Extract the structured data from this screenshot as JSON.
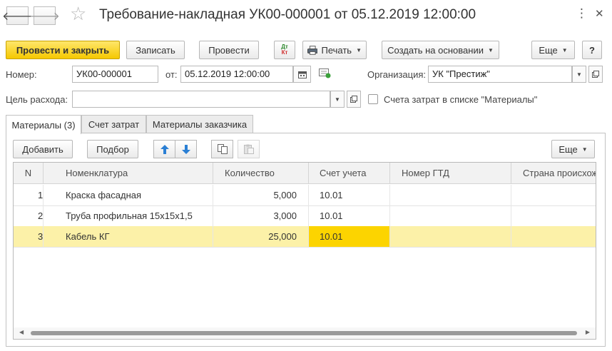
{
  "header": {
    "title": "Требование-накладная УК00-000001 от 05.12.2019 12:00:00",
    "back_icon": "arrow-left-icon",
    "forward_icon": "arrow-right-icon",
    "favorite_icon": "star-icon",
    "more_icon": "vertical-dots-icon",
    "close_icon": "close-icon",
    "back_glyph": "🡐",
    "forward_glyph": "🡒",
    "star_glyph": "☆",
    "dots_glyph": "⋮",
    "close_glyph": "✕"
  },
  "commandbar": {
    "post_and_close": "Провести и закрыть",
    "save": "Записать",
    "post": "Провести",
    "dt_label": "Дт",
    "kt_label": "Кт",
    "print": "Печать",
    "create_based_on": "Создать на основании",
    "more": "Еще",
    "help": "?"
  },
  "form": {
    "number_label": "Номер:",
    "number_value": "УК00-000001",
    "date_label": "от:",
    "date_value": "05.12.2019 12:00:00",
    "org_label": "Организация:",
    "org_value": "УК \"Престиж\"",
    "purpose_label": "Цель расхода:",
    "purpose_value": "",
    "cost_accounts_checkbox_label": "Счета затрат в списке \"Материалы\"",
    "cost_accounts_checked": false
  },
  "tabs": [
    {
      "label": "Материалы (3)",
      "active": true
    },
    {
      "label": "Счет затрат",
      "active": false
    },
    {
      "label": "Материалы заказчика",
      "active": false
    }
  ],
  "table_toolbar": {
    "add": "Добавить",
    "pick": "Подбор",
    "more": "Еще"
  },
  "table": {
    "columns": [
      "N",
      "Номенклатура",
      "Количество",
      "Счет учета",
      "Номер ГТД",
      "Страна происхож"
    ],
    "rows": [
      {
        "n": "1",
        "item": "Краска фасадная",
        "qty": "5,000",
        "account": "10.01",
        "gtd": "",
        "country": ""
      },
      {
        "n": "2",
        "item": "Труба профильная 15х15х1,5",
        "qty": "3,000",
        "account": "10.01",
        "gtd": "",
        "country": ""
      },
      {
        "n": "3",
        "item": "Кабель КГ",
        "qty": "25,000",
        "account": "10.01",
        "gtd": "",
        "country": ""
      }
    ],
    "selected_row": 3
  },
  "colors": {
    "primary_button": "#f5c800",
    "selected_row": "#fcf1a8",
    "focused_cell": "#fcd400"
  }
}
